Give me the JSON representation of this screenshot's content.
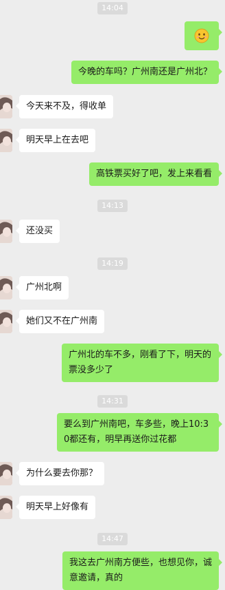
{
  "chat": {
    "timestamps": [
      "14:04",
      "14:13",
      "14:19",
      "14:31",
      "14:47"
    ],
    "messages": [
      {
        "side": "right",
        "emoji": "smile-emoji"
      },
      {
        "side": "right",
        "text": "今晚的车吗？广州南还是广州北？"
      },
      {
        "side": "left",
        "text": "今天来不及，得收单"
      },
      {
        "side": "left",
        "text": "明天早上在去吧"
      },
      {
        "side": "right",
        "text": "高铁票买好了吧，发上来看看"
      },
      {
        "side": "left",
        "text": "还没买"
      },
      {
        "side": "left",
        "text": "广州北啊"
      },
      {
        "side": "left",
        "text": "她们又不在广州南"
      },
      {
        "side": "right",
        "text": "广州北的车不多，刚看了下，明天的票没多少了"
      },
      {
        "side": "right",
        "text": "要么到广州南吧，车多些，晚上10:30都还有，明早再送你过花都"
      },
      {
        "side": "left",
        "text": "为什么要去你那？"
      },
      {
        "side": "left",
        "text": "明天早上好像有"
      },
      {
        "side": "right",
        "text": "我这去广州南方便些，也想见你，诚意邀请，真的"
      }
    ]
  },
  "colors": {
    "background": "#ededed",
    "outgoing_bubble": "#95ec69",
    "incoming_bubble": "#ffffff",
    "timestamp_pill": "#dadada"
  }
}
